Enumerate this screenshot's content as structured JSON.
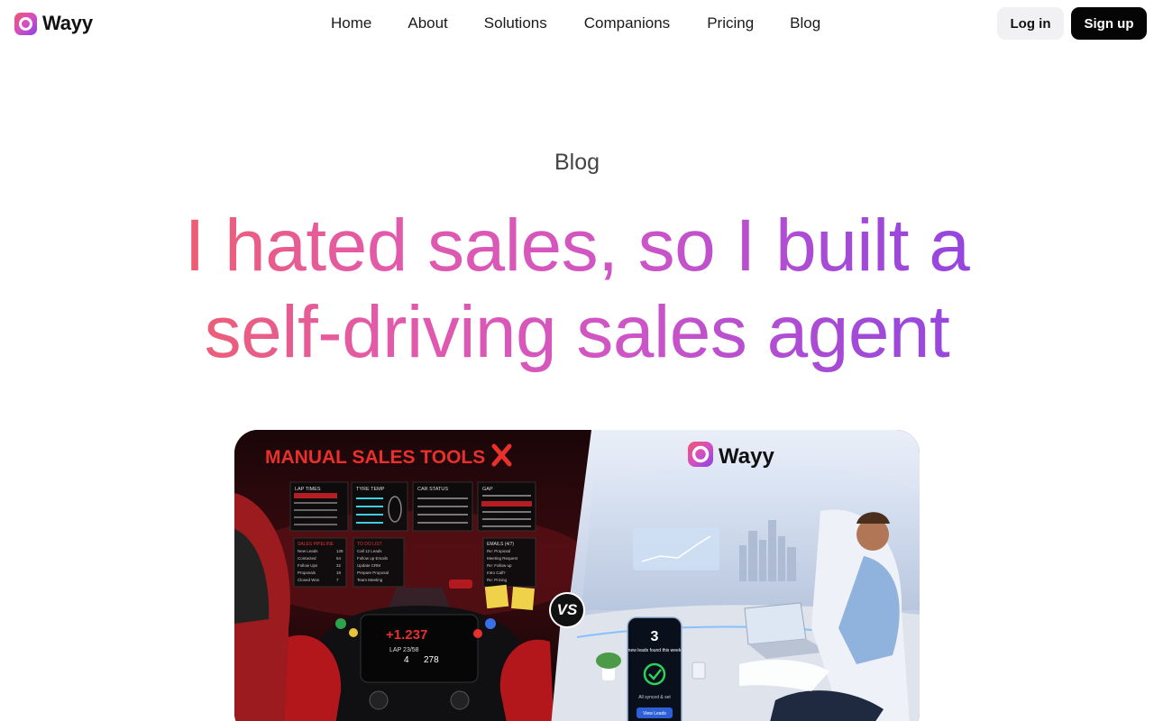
{
  "brand": {
    "name": "Wayy",
    "logo_icon": "wayy-logo-icon"
  },
  "nav": {
    "items": [
      {
        "label": "Home"
      },
      {
        "label": "About"
      },
      {
        "label": "Solutions"
      },
      {
        "label": "Companions"
      },
      {
        "label": "Pricing"
      },
      {
        "label": "Blog"
      }
    ],
    "login_label": "Log in",
    "signup_label": "Sign up"
  },
  "hero": {
    "eyebrow": "Blog",
    "title": "I hated sales, so I built a self-driving sales agent"
  },
  "illustration": {
    "left_title": "MANUAL SALES TOOLS",
    "right_brand": "Wayy",
    "vs_label": "VS",
    "lap_times_title": "LAP TIMES",
    "tyre_temp_title": "TYRE TEMP",
    "car_status_title": "CAR STATUS",
    "gap_title": "GAP",
    "sales_pipeline_title": "SALES PIPELINE",
    "todo_title": "TO DO LIST",
    "emails_title": "EMAILS (4/7)",
    "pipeline_rows": [
      {
        "label": "New Leads",
        "value": "128"
      },
      {
        "label": "Contacted",
        "value": "64"
      },
      {
        "label": "Follow Ups",
        "value": "32"
      },
      {
        "label": "Proposals",
        "value": "18"
      },
      {
        "label": "Closed Won",
        "value": "7"
      }
    ],
    "todo_items": [
      "Call 12 Leads",
      "Follow up Emails",
      "Update CRM",
      "Prepare Proposal",
      "Team Meeting"
    ],
    "email_items": [
      "Re: Proposal",
      "Meeting Request",
      "Re: Follow up",
      "Intro Call?",
      "Re: Pricing"
    ],
    "dash_delta": "+1.237",
    "dash_lap": "LAP 23/58",
    "dash_speed": "278",
    "dash_gear": "4",
    "phone_count": "3",
    "phone_text": "new leads found this week",
    "phone_status": "All synced & set",
    "phone_button": "View Leads"
  },
  "colors": {
    "gradient_start": "#ef6064",
    "gradient_mid": "#cf55c6",
    "gradient_end": "#8e44e2",
    "signup_bg": "#050505",
    "login_bg": "#f1f1f3"
  }
}
